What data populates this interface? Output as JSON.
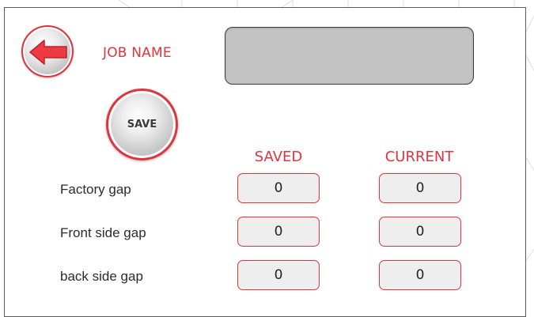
{
  "header": {
    "back_icon": "arrow-left-icon",
    "job_name_label": "JOB NAME",
    "job_name_value": ""
  },
  "save_button": {
    "label": "SAVE"
  },
  "table": {
    "columns": [
      "SAVED",
      "CURRENT"
    ],
    "rows": [
      {
        "label": "Factory gap",
        "saved": "0",
        "current": "0"
      },
      {
        "label": "Front side gap",
        "saved": "0",
        "current": "0"
      },
      {
        "label": "back side gap",
        "saved": "0",
        "current": "0"
      }
    ]
  },
  "colors": {
    "accent": "#e0343d",
    "input_bg": "#c3c3c3",
    "value_bg": "#eeeeee"
  }
}
